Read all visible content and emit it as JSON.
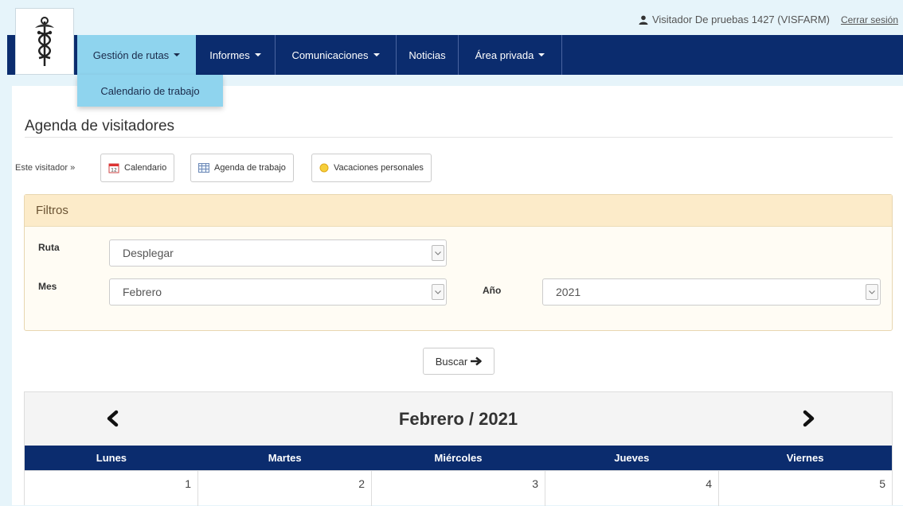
{
  "user": {
    "name": "Visitador De pruebas 1427 (VISFARM)",
    "logout_label": "Cerrar sesión"
  },
  "nav": {
    "items": [
      {
        "label": "Gestión de rutas",
        "has_caret": true
      },
      {
        "label": "Informes",
        "has_caret": true
      },
      {
        "label": "Comunicaciones",
        "has_caret": true
      },
      {
        "label": "Noticias",
        "has_caret": false
      },
      {
        "label": "Área privada",
        "has_caret": true
      }
    ],
    "dropdown_item": "Calendario de trabajo"
  },
  "page": {
    "title": "Agenda de visitadores",
    "visitor_label": "Este visitador »",
    "buttons": [
      {
        "label": "Calendario",
        "icon": "calendar-icon"
      },
      {
        "label": "Agenda de trabajo",
        "icon": "table-icon"
      },
      {
        "label": "Vacaciones personales",
        "icon": "sun-dot-icon"
      }
    ]
  },
  "filters": {
    "title": "Filtros",
    "ruta_label": "Ruta",
    "ruta_value": "Desplegar",
    "mes_label": "Mes",
    "mes_value": "Febrero",
    "anio_label": "Año",
    "anio_value": "2021",
    "search_label": "Buscar"
  },
  "calendar": {
    "title": "Febrero / 2021",
    "days": [
      "Lunes",
      "Martes",
      "Miércoles",
      "Jueves",
      "Viernes"
    ],
    "first_row": [
      "1",
      "2",
      "3",
      "4",
      "5"
    ]
  },
  "colors": {
    "nav_bg": "#0b2c6e",
    "nav_active": "#8fd4ee",
    "page_bg": "#e6f4fa",
    "filter_head": "#fcebc9"
  }
}
